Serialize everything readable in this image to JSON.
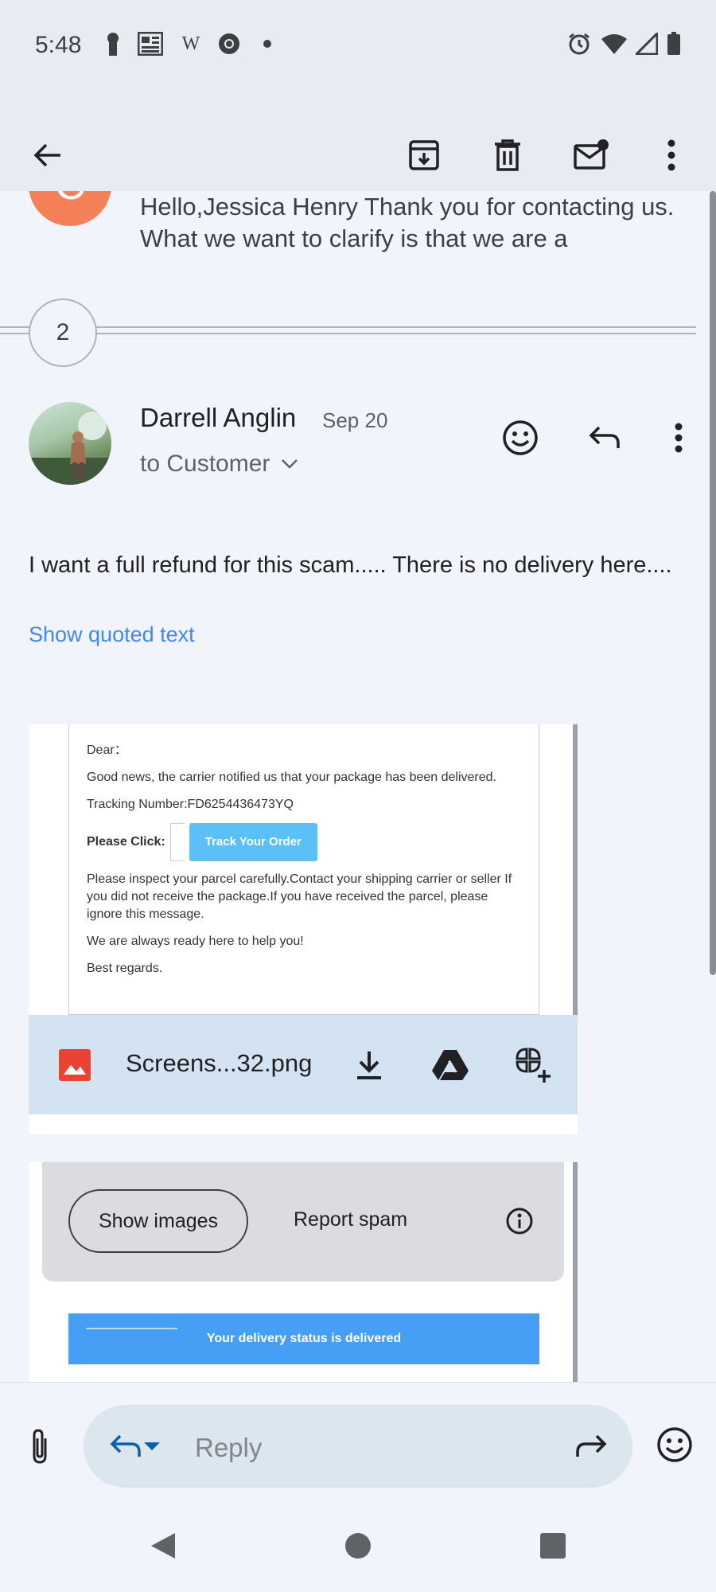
{
  "status_bar": {
    "time": "5:48",
    "left_icons": [
      "keyhole-icon",
      "newspaper-icon",
      "w-icon",
      "chrome-icon",
      "dot-icon"
    ],
    "w_label": "W",
    "right_icons": [
      "alarm-icon",
      "wifi-icon",
      "signal-icon",
      "battery-icon"
    ]
  },
  "app_bar": {
    "icons": [
      "back-arrow-icon",
      "archive-icon",
      "delete-icon",
      "mark-unread-icon",
      "more-vert-icon"
    ]
  },
  "previous_message": {
    "avatar_letter": "C",
    "avatar_color": "#f48057",
    "snippet": "Hello,Jessica Henry Thank you for contacting us. What we want to clarify is that we are a"
  },
  "collapsed": {
    "count": "2"
  },
  "message": {
    "sender": "Darrell Anglin",
    "date": "Sep 20",
    "recipient": "to Customer",
    "body": "I want a full refund for this scam..... There is no delivery here....",
    "show_quoted": "Show quoted text"
  },
  "attachment": {
    "preview": {
      "greeting": "Dear：",
      "line1": "Good news, the carrier notified us that your package has been delivered.",
      "tracking": "Tracking Number:FD6254436473YQ",
      "please_click": "Please Click:",
      "track_button": "Track Your Order",
      "inspect": "Please inspect your parcel carefully.Contact your shipping carrier or seller If you did not receive the package.If you have received the parcel, please ignore this message.",
      "ready": "We are always ready here to help you!",
      "regards": "Best regards."
    },
    "filename": "Screens...32.png",
    "icons": [
      "image-file-icon",
      "download-icon",
      "drive-icon",
      "add-to-photos-icon"
    ]
  },
  "images_blocked": {
    "show_images": "Show images",
    "report_spam": "Report spam",
    "banner_text": "Your delivery status is delivered"
  },
  "reply_bar": {
    "placeholder": "Reply",
    "icons": [
      "attach-icon",
      "reply-icon",
      "dropdown-icon",
      "forward-icon",
      "emoji-icon"
    ]
  },
  "nav_bar": {
    "icons": [
      "back-triangle-icon",
      "home-circle-icon",
      "recents-square-icon"
    ]
  },
  "colors": {
    "accent_blue": "#4285f4",
    "track_button": "#5bc0f8",
    "banner_blue": "#479ff5",
    "attachment_bar": "#d4e3f1"
  }
}
